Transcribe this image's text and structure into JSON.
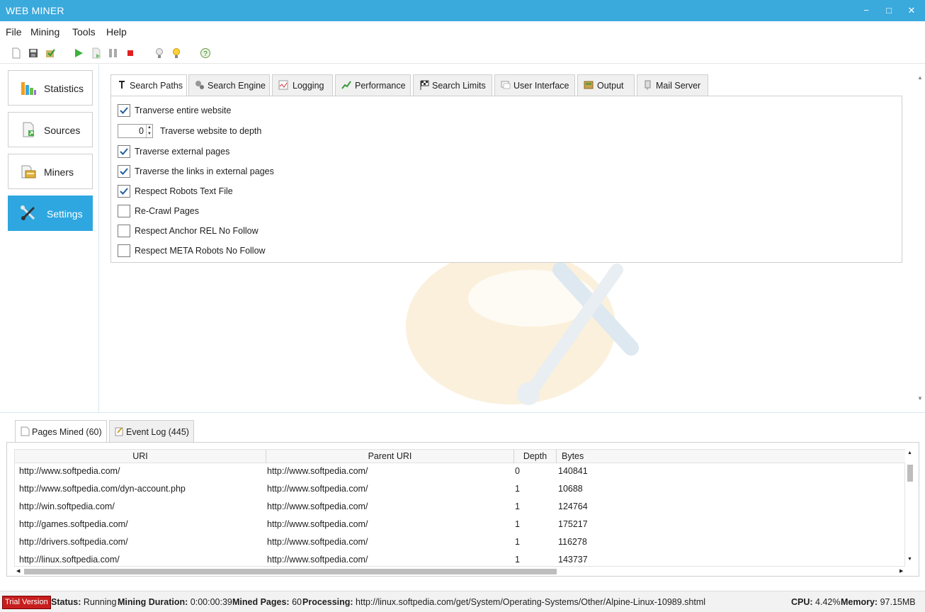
{
  "window": {
    "title": "WEB MINER",
    "minimize": "−",
    "maximize": "□",
    "close": "✕"
  },
  "menu": [
    "File",
    "Mining",
    "Tools",
    "Help"
  ],
  "toolbar": [
    "new-icon",
    "save-icon",
    "save-as-icon",
    "start-icon",
    "step-icon",
    "pause-icon",
    "stop-icon",
    "bulb-off-icon",
    "bulb-on-icon",
    "help-icon"
  ],
  "nav": {
    "items": [
      {
        "label": "Statistics",
        "icon": "statistics-icon"
      },
      {
        "label": "Sources",
        "icon": "sources-icon"
      },
      {
        "label": "Miners",
        "icon": "miners-icon"
      },
      {
        "label": "Settings",
        "icon": "settings-icon",
        "active": true
      }
    ]
  },
  "settings": {
    "tabs": [
      {
        "label": "Search Paths",
        "active": true
      },
      {
        "label": "Search Engine"
      },
      {
        "label": "Logging"
      },
      {
        "label": "Performance"
      },
      {
        "label": "Search Limits"
      },
      {
        "label": "User Interface"
      },
      {
        "label": "Output"
      },
      {
        "label": "Mail Server"
      }
    ],
    "options": [
      {
        "label": "Tranverse entire website",
        "checked": true
      },
      {
        "label": "Traverse external pages",
        "checked": true
      },
      {
        "label": "Traverse the links in external pages",
        "checked": true
      },
      {
        "label": "Respect Robots Text File",
        "checked": true
      },
      {
        "label": "Re-Crawl Pages",
        "checked": false
      },
      {
        "label": "Respect Anchor REL No Follow",
        "checked": false
      },
      {
        "label": "Respect META Robots No Follow",
        "checked": false
      }
    ],
    "depth": {
      "value": "0",
      "label": "Traverse website to depth"
    }
  },
  "bottom": {
    "tabs": [
      {
        "label": "Pages Mined (60)",
        "active": true
      },
      {
        "label": "Event Log (445)"
      }
    ],
    "columns": [
      "URI",
      "Parent URI",
      "Depth",
      "Bytes"
    ],
    "rows": [
      [
        "http://www.softpedia.com/",
        "http://www.softpedia.com/",
        "0",
        "140841"
      ],
      [
        "http://www.softpedia.com/dyn-account.php",
        "http://www.softpedia.com/",
        "1",
        "10688"
      ],
      [
        "http://win.softpedia.com/",
        "http://www.softpedia.com/",
        "1",
        "124764"
      ],
      [
        "http://games.softpedia.com/",
        "http://www.softpedia.com/",
        "1",
        "175217"
      ],
      [
        "http://drivers.softpedia.com/",
        "http://www.softpedia.com/",
        "1",
        "116278"
      ],
      [
        "http://linux.softpedia.com/",
        "http://www.softpedia.com/",
        "1",
        "143737"
      ]
    ]
  },
  "status": {
    "trial": "Trial Version",
    "status_label": "Status:",
    "status_value": "Running",
    "duration_label": "Mining Duration:",
    "duration_value": "0:00:00:39",
    "mined_label": "Mined Pages:",
    "mined_value": "60",
    "processing_label": "Processing:",
    "processing_value": "http://linux.softpedia.com/get/System/Operating-Systems/Other/Alpine-Linux-10989.shtml",
    "cpu_label": "CPU:",
    "cpu_value": "4.42%",
    "memory_label": "Memory:",
    "memory_value": "97.15MB"
  },
  "colors": {
    "titlebar": "#3aa9dc",
    "active_nav": "#2ea7e0",
    "trial": "#c81e1e"
  }
}
